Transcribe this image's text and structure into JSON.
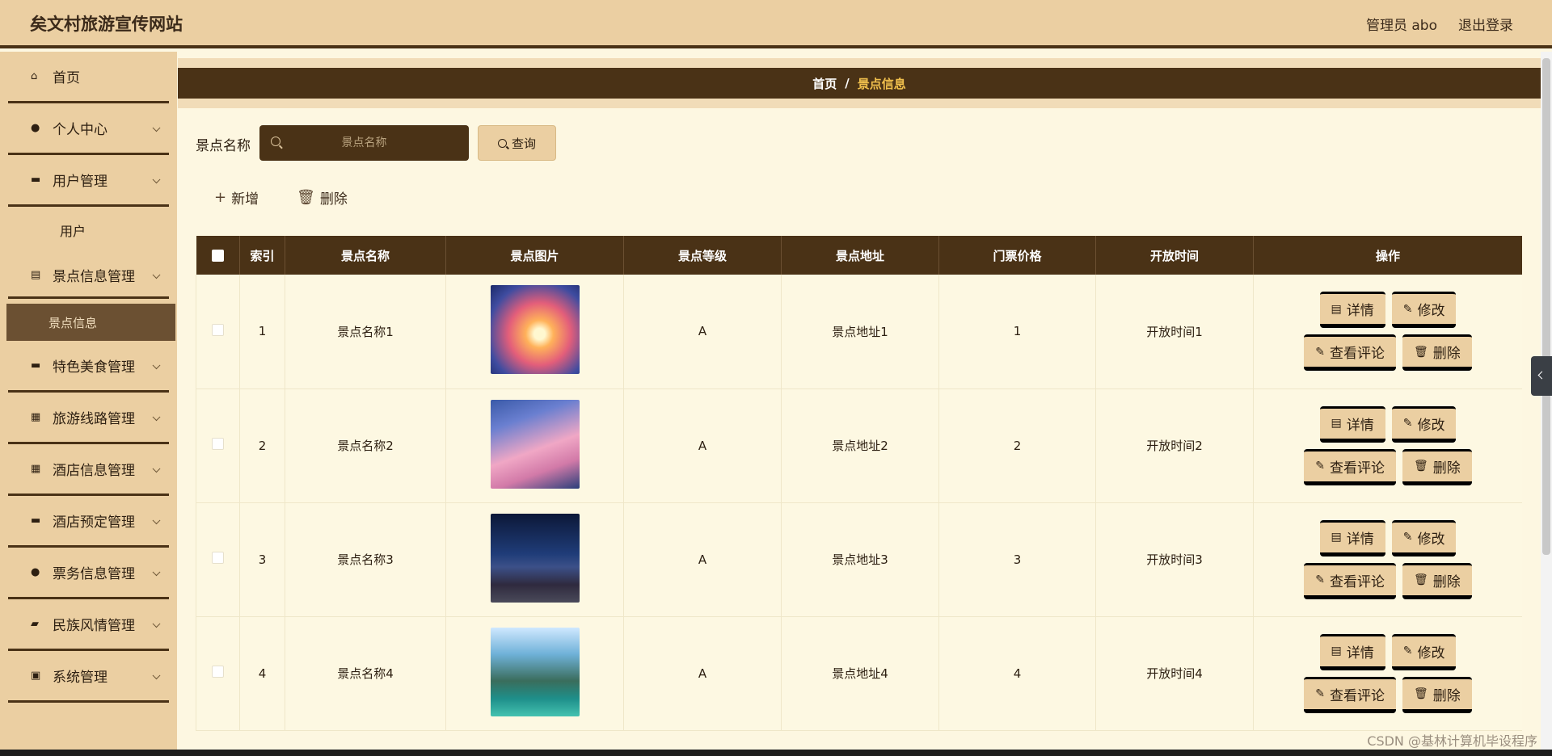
{
  "header": {
    "title": "矣文村旅游宣传网站",
    "user": "管理员 abo",
    "logout": "退出登录"
  },
  "sidebar": {
    "items": [
      {
        "label": "首页",
        "icon": "home-icon",
        "expandable": false
      },
      {
        "label": "个人中心",
        "icon": "user-icon",
        "expandable": true
      },
      {
        "label": "用户管理",
        "icon": "monitor-icon",
        "expandable": true,
        "sub": [
          "用户"
        ]
      },
      {
        "label": "景点信息管理",
        "icon": "clipboard-icon",
        "expandable": true,
        "sub": [
          "景点信息"
        ]
      },
      {
        "label": "特色美食管理",
        "icon": "bowl-icon",
        "expandable": true
      },
      {
        "label": "旅游线路管理",
        "icon": "grid-icon",
        "expandable": true
      },
      {
        "label": "酒店信息管理",
        "icon": "grid-icon",
        "expandable": true
      },
      {
        "label": "酒店预定管理",
        "icon": "chat-icon",
        "expandable": true
      },
      {
        "label": "票务信息管理",
        "icon": "person-icon",
        "expandable": true
      },
      {
        "label": "民族风情管理",
        "icon": "wallet-icon",
        "expandable": true
      },
      {
        "label": "系统管理",
        "icon": "clipboard-x-icon",
        "expandable": true
      }
    ]
  },
  "breadcrumb": {
    "home": "首页",
    "sep": "/",
    "current": "景点信息"
  },
  "search": {
    "label": "景点名称",
    "placeholder": "景点名称",
    "button": "查询"
  },
  "toolbar": {
    "add": "新增",
    "delete": "删除"
  },
  "table": {
    "columns": [
      "索引",
      "景点名称",
      "景点图片",
      "景点等级",
      "景点地址",
      "门票价格",
      "开放时间",
      "操作"
    ],
    "rows": [
      {
        "index": "1",
        "name": "景点名称1",
        "grade": "A",
        "address": "景点地址1",
        "price": "1",
        "hours": "开放时间1"
      },
      {
        "index": "2",
        "name": "景点名称2",
        "grade": "A",
        "address": "景点地址2",
        "price": "2",
        "hours": "开放时间2"
      },
      {
        "index": "3",
        "name": "景点名称3",
        "grade": "A",
        "address": "景点地址3",
        "price": "3",
        "hours": "开放时间3"
      },
      {
        "index": "4",
        "name": "景点名称4",
        "grade": "A",
        "address": "景点地址4",
        "price": "4",
        "hours": "开放时间4"
      }
    ],
    "actions": {
      "detail": "详情",
      "edit": "修改",
      "comments": "查看评论",
      "delete": "删除"
    }
  },
  "watermark": "CSDN @基林计算机毕设程序",
  "colors": {
    "header_bg": "#ebcfa2",
    "dark_brown": "#4a3216",
    "content_bg": "#fdf7e1",
    "active_crumb": "#f1c04d"
  }
}
